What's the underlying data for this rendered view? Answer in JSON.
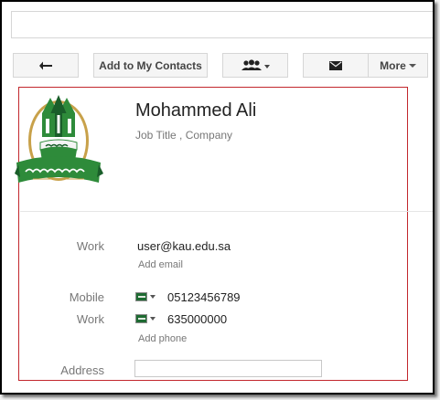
{
  "toolbar": {
    "back_icon": "back-arrow-icon",
    "add_contacts_label": "Add to My Contacts",
    "groups_icon": "people-icon",
    "mail_icon": "envelope-icon",
    "more_label": "More"
  },
  "contact": {
    "name": "Mohammed Ali",
    "subtitle": "Job Title ,  Company",
    "email_label": "Work",
    "email": "user@kau.edu.sa",
    "add_email": "Add email",
    "phones": [
      {
        "label": "Mobile",
        "number": "05123456789"
      },
      {
        "label": "Work",
        "number": "635000000"
      }
    ],
    "add_phone": "Add phone",
    "address_label": "Address",
    "address_value": ""
  },
  "colors": {
    "highlight_border": "#c2272d",
    "logo_green": "#2e8b3a",
    "logo_dark_green": "#1a5e2a",
    "logo_gold": "#c8a14a"
  }
}
